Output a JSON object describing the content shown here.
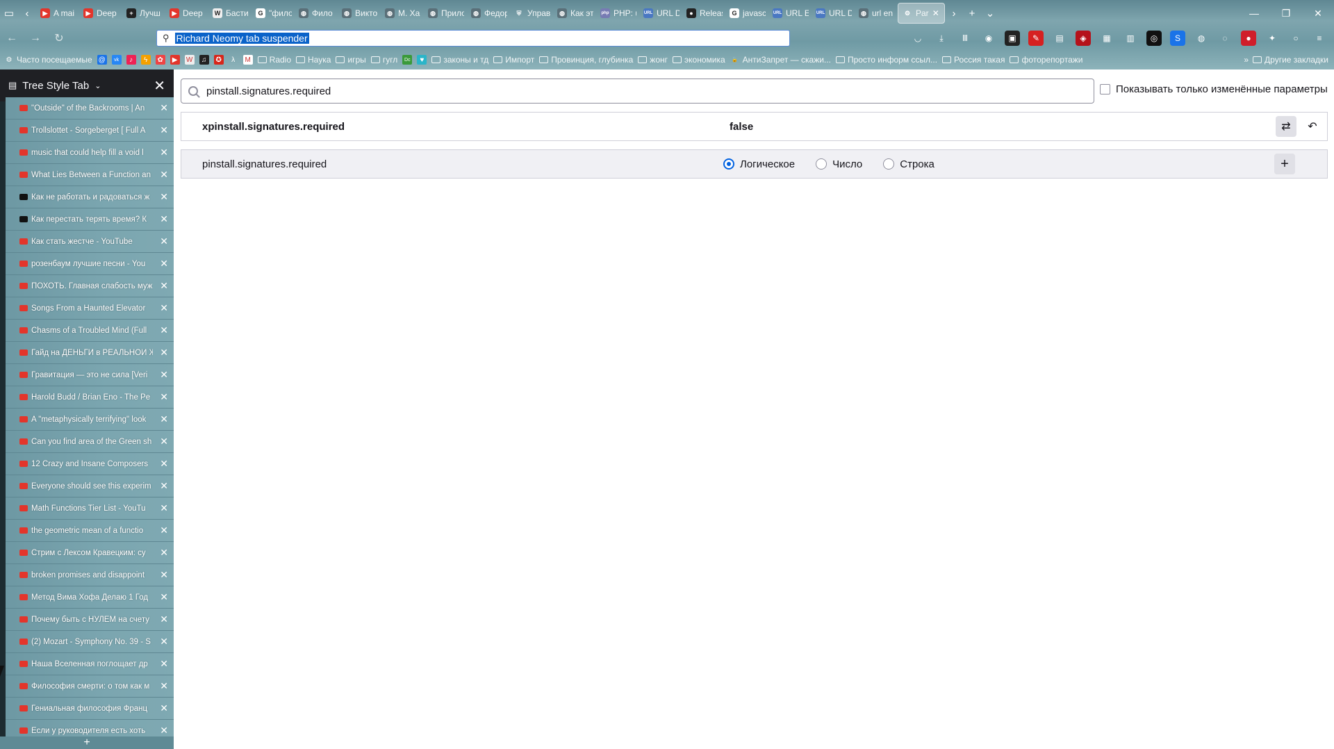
{
  "tabs": [
    {
      "label": "A mai",
      "favicon": "youtube"
    },
    {
      "label": "Deep",
      "favicon": "youtube"
    },
    {
      "label": "Лучш",
      "favicon": "plus"
    },
    {
      "label": "Deep",
      "favicon": "youtube"
    },
    {
      "label": "Басти",
      "favicon": "wikipedia"
    },
    {
      "label": "\"фило",
      "favicon": "google"
    },
    {
      "label": "Фило",
      "favicon": "globe"
    },
    {
      "label": "Викто",
      "favicon": "globe"
    },
    {
      "label": "М. Ха",
      "favicon": "globe"
    },
    {
      "label": "Прило",
      "favicon": "globe"
    },
    {
      "label": "Федор",
      "favicon": "globe"
    },
    {
      "label": "Управ",
      "favicon": "shield"
    },
    {
      "label": "Как эт",
      "favicon": "globe"
    },
    {
      "label": "PHP: u",
      "favicon": "php"
    },
    {
      "label": "URL D",
      "favicon": "url"
    },
    {
      "label": "Releas",
      "favicon": "github"
    },
    {
      "label": "javasc",
      "favicon": "google"
    },
    {
      "label": "URL E",
      "favicon": "url"
    },
    {
      "label": "URL D",
      "favicon": "url"
    },
    {
      "label": "url en",
      "favicon": "globe"
    },
    {
      "label": "Par",
      "favicon": "gear",
      "active": true
    }
  ],
  "urlbar": {
    "value": "Richard Neomy tab suspender"
  },
  "bookmarks": [
    {
      "label": "Часто посещаемые",
      "icon": "gear"
    },
    {
      "label": "",
      "icon": "at"
    },
    {
      "label": "",
      "icon": "vk"
    },
    {
      "label": "",
      "icon": "music"
    },
    {
      "label": "",
      "icon": "bolt"
    },
    {
      "label": "",
      "icon": "flower"
    },
    {
      "label": "",
      "icon": "youtube"
    },
    {
      "label": "",
      "icon": "wikipedia"
    },
    {
      "label": "",
      "icon": "note"
    },
    {
      "label": "",
      "icon": "star"
    },
    {
      "label": "",
      "icon": "lambda"
    },
    {
      "label": "",
      "icon": "gmail"
    },
    {
      "label": "Radio",
      "icon": "folder"
    },
    {
      "label": "Наука",
      "icon": "folder"
    },
    {
      "label": "игры",
      "icon": "folder"
    },
    {
      "label": "гугл",
      "icon": "folder"
    },
    {
      "label": "",
      "icon": "dc"
    },
    {
      "label": "",
      "icon": "heart"
    },
    {
      "label": "законы и тд",
      "icon": "folder"
    },
    {
      "label": "Импорт",
      "icon": "folder"
    },
    {
      "label": "Провинция, глубинка",
      "icon": "folder"
    },
    {
      "label": "жонг",
      "icon": "folder"
    },
    {
      "label": "экономика",
      "icon": "folder"
    },
    {
      "label": "АнтиЗапрет — скажи...",
      "icon": "lock"
    },
    {
      "label": "Просто информ ссыл...",
      "icon": "folder"
    },
    {
      "label": "Россия такая",
      "icon": "folder"
    },
    {
      "label": "фоторепортажи",
      "icon": "folder"
    }
  ],
  "other_bookmarks": "Другие закладки",
  "sidebar": {
    "title": "Tree Style Tab",
    "items": [
      {
        "title": "\"Outside\" of the Backrooms | An",
        "favicon": "youtube"
      },
      {
        "title": "Trollslottet - Sorgeberget [ Full A",
        "favicon": "youtube"
      },
      {
        "title": "music that could help fill a void l",
        "favicon": "youtube"
      },
      {
        "title": "What Lies Between a Function an",
        "favicon": "youtube"
      },
      {
        "title": "Как не работать и радоваться ж",
        "favicon": "cup"
      },
      {
        "title": "Как перестать терять время? К",
        "favicon": "cup"
      },
      {
        "title": "Как стать жестче - YouTube",
        "favicon": "youtube"
      },
      {
        "title": "розенбаум лучшие песни - You",
        "favicon": "youtube"
      },
      {
        "title": "ПОХОТЬ. Главная слабость муж",
        "favicon": "youtube"
      },
      {
        "title": "Songs From a Haunted Elevator",
        "favicon": "youtube"
      },
      {
        "title": "Chasms of a Troubled Mind (Full",
        "favicon": "youtube"
      },
      {
        "title": "Гайд на ДЕНЬГИ в РЕАЛЬНОЙ Ж",
        "favicon": "youtube"
      },
      {
        "title": "Гравитация — это не сила [Veri",
        "favicon": "youtube"
      },
      {
        "title": "Harold Budd / Brian Eno - The Pe",
        "favicon": "youtube"
      },
      {
        "title": "A \"metaphysically terrifying\" look",
        "favicon": "youtube"
      },
      {
        "title": "Can you find area of the Green sh",
        "favicon": "youtube"
      },
      {
        "title": "12 Crazy and Insane Composers",
        "favicon": "youtube"
      },
      {
        "title": "Everyone should see this experim",
        "favicon": "youtube"
      },
      {
        "title": "Math Functions Tier List - YouTu",
        "favicon": "youtube"
      },
      {
        "title": "the geometric mean of a functio",
        "favicon": "youtube"
      },
      {
        "title": "Стрим с Лексом Кравецким: су",
        "favicon": "youtube"
      },
      {
        "title": "broken promises and disappoint",
        "favicon": "youtube"
      },
      {
        "title": "Метод Вима Хофа Делаю 1 Год",
        "favicon": "youtube"
      },
      {
        "title": "Почему быть с НУЛЕМ на счету",
        "favicon": "youtube"
      },
      {
        "title": "(2) Mozart - Symphony No. 39 - S",
        "favicon": "youtube"
      },
      {
        "title": "Наша Вселенная поглощает др",
        "favicon": "youtube"
      },
      {
        "title": "Философия смерти: о том как м",
        "favicon": "youtube"
      },
      {
        "title": "Гениальная философия Франц",
        "favicon": "youtube"
      },
      {
        "title": "Если у руководителя есть хоть",
        "favicon": "youtube"
      }
    ]
  },
  "config": {
    "search_value": "pinstall.signatures.required",
    "show_modified_label": "Показывать только изменённые параметры",
    "row1": {
      "name": "xpinstall.signatures.required",
      "value": "false"
    },
    "row2": {
      "name": "pinstall.signatures.required",
      "types": [
        "Логическое",
        "Число",
        "Строка"
      ],
      "selected": "Логическое"
    }
  },
  "colors": {
    "accent": "#0061e0",
    "youtube": "#e3352b"
  }
}
